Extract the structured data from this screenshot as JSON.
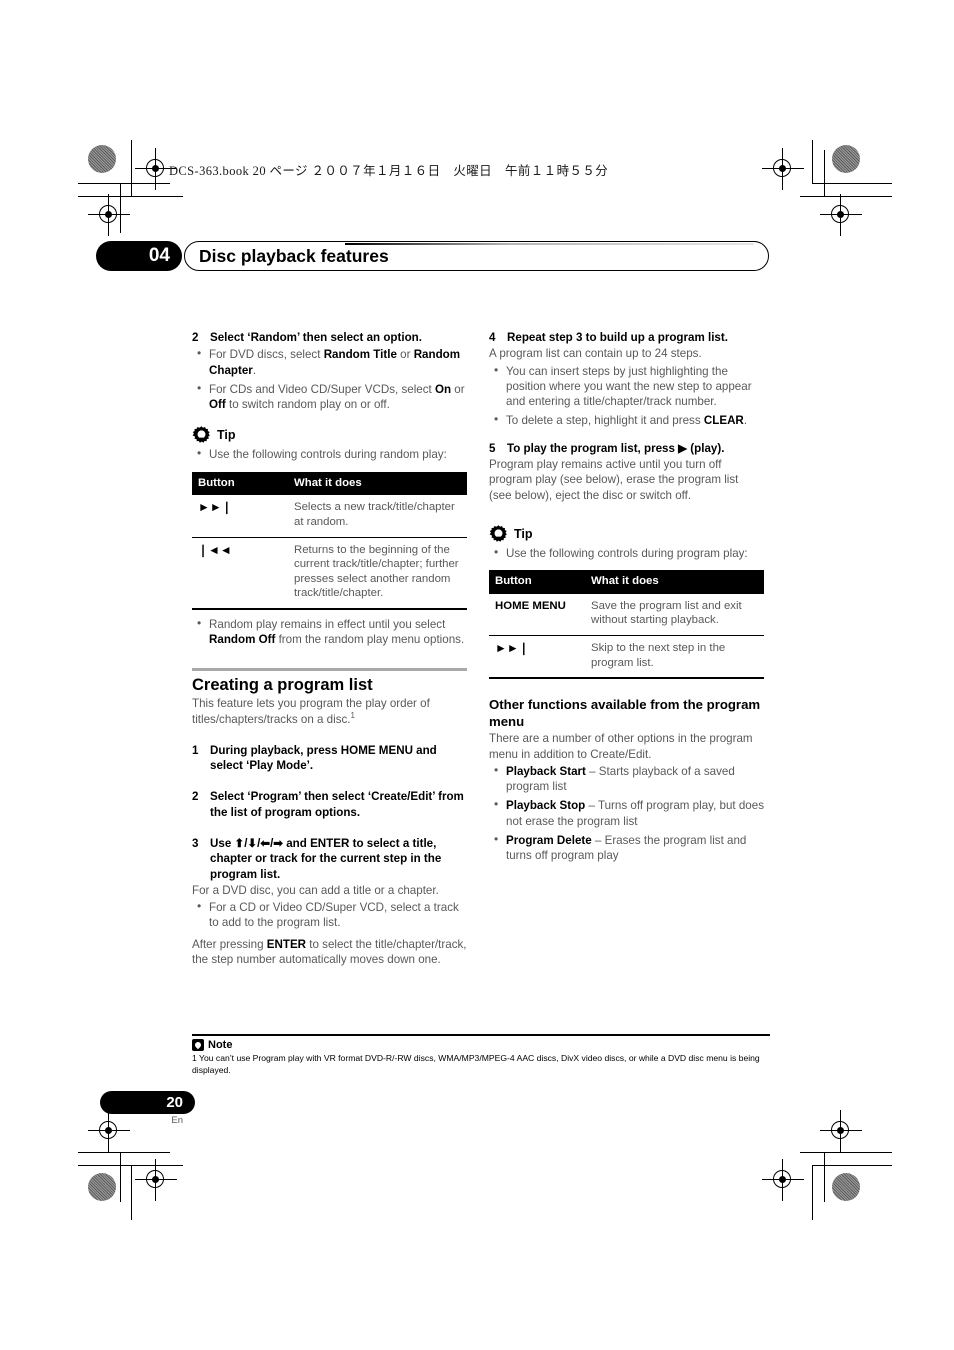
{
  "print_marks": {
    "header_line": "DCS-363.book  20 ページ  ２００７年１月１６日　火曜日　午前１１時５５分"
  },
  "chapter": {
    "number": "04",
    "title": "Disc playback features"
  },
  "left_column": {
    "step2": {
      "num": "2",
      "text_html": "Select ‘Random’ then select an option.",
      "bullets_html": [
        "For DVD discs, select <b>Random Title</b> or <b>Random Chapter</b>.",
        "For CDs and Video CD/Super VCDs, select <b>On</b> or <b>Off</b> to switch random play on or off."
      ]
    },
    "tip": {
      "label": "Tip",
      "bullets_html": [
        "Use the following controls during random play:"
      ]
    },
    "table": {
      "headers": [
        "Button",
        "What it does"
      ],
      "rows": [
        {
          "button": "►►❘",
          "what": "Selects a new track/title/chapter at random."
        },
        {
          "button": "❘◄◄",
          "what": "Returns to the beginning of the current track/title/chapter; further presses select another random track/title/chapter."
        }
      ]
    },
    "after_table_bullets_html": [
      "Random play remains in effect until you select <b>Random Off</b> from the random play menu options."
    ],
    "section": {
      "title": "Creating a program list",
      "intro_html": "This feature lets you program the play order of titles/chapters/tracks on a disc.<sup>1</sup>"
    },
    "step1": {
      "num": "1",
      "text_html": "During playback, press HOME MENU and select ‘Play Mode’."
    },
    "step2b": {
      "num": "2",
      "text_html": "Select ‘Program’ then select ‘Create/Edit’ from the list of program options."
    },
    "step3": {
      "num": "3",
      "text_html": "Use ⬆/⬇/⬅/➡ and ENTER to select a title, chapter or track for the current step in the program list."
    },
    "step3_body": "For a DVD disc, you can add a title or a chapter.",
    "step3_bullets_html": [
      "For a CD or Video CD/Super VCD, select a track to add to the program list."
    ],
    "step3_after_html": "After pressing <b>ENTER</b> to select the title/chapter/track, the step number automatically moves down one."
  },
  "right_column": {
    "step4": {
      "num": "4",
      "text_html": "Repeat step 3 to build up a program list.",
      "body": "A program list can contain up to 24 steps.",
      "bullets_html": [
        "You can insert steps by just highlighting the position where you want the new step to appear and entering a title/chapter/track number.",
        "To delete a step, highlight it and press <b>CLEAR</b>."
      ]
    },
    "step5": {
      "num": "5",
      "text_html": "To play the program list, press ▶ (play).",
      "body": "Program play remains active until you turn off program play (see below), erase the program list (see below), eject the disc or switch off."
    },
    "tip": {
      "label": "Tip",
      "bullets_html": [
        "Use the following controls during program play:"
      ]
    },
    "table": {
      "headers": [
        "Button",
        "What it does"
      ],
      "rows": [
        {
          "button": "HOME MENU",
          "what": "Save the program list and exit without starting playback."
        },
        {
          "button": "►►❘",
          "what": "Skip to the next step in the program list."
        }
      ]
    },
    "subsection": {
      "title": "Other functions available from the program menu",
      "intro": "There are a number of other options in the program menu in addition to Create/Edit.",
      "bullets_html": [
        "<b>Playback Start</b> – Starts playback of a saved program list",
        "<b>Playback Stop</b> – Turns off program play, but does not erase the program list",
        "<b>Program Delete</b> – Erases the program list and turns off program play"
      ]
    }
  },
  "note": {
    "label": "Note",
    "text": "1 You can’t use Program play with VR format DVD-R/-RW discs, WMA/MP3/MPEG-4 AAC discs, DivX video discs, or while a DVD disc menu is being displayed."
  },
  "footer": {
    "page_number": "20",
    "language": "En"
  },
  "colors": {
    "body_text": "#58595b",
    "heading": "#000000",
    "rule": "#a7a9ac"
  }
}
